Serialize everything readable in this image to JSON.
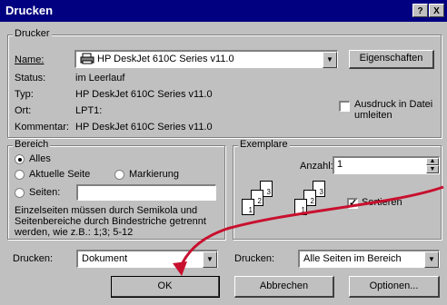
{
  "window": {
    "title": "Drucken",
    "help_glyph": "?",
    "close_glyph": "X"
  },
  "printer": {
    "group_label": "Drucker",
    "name_label": "Name:",
    "name_value": "HP DeskJet 610C Series v11.0",
    "properties_button": "Eigenschaften",
    "status_label": "Status:",
    "status_value": "im Leerlauf",
    "type_label": "Typ:",
    "type_value": "HP DeskJet 610C Series v11.0",
    "location_label": "Ort:",
    "location_value": "LPT1:",
    "comment_label": "Kommentar:",
    "comment_value": "HP DeskJet 610C Series v11.0",
    "print_to_file_label": "Ausdruck in Datei umleiten",
    "print_to_file_checked": false
  },
  "range": {
    "group_label": "Bereich",
    "all_label": "Alles",
    "current_page_label": "Aktuelle Seite",
    "selection_label": "Markierung",
    "pages_label": "Seiten:",
    "pages_value": "",
    "hint": "Einzelseiten müssen durch Semikola und Seitenbereiche durch Bindestriche getrennt werden, wie z.B.: 1;3; 5-12",
    "selected": "all"
  },
  "copies": {
    "group_label": "Exemplare",
    "count_label": "Anzahl:",
    "count_value": "1",
    "collate_label": "Sortieren",
    "collate_checked": true,
    "collate_icon_pages": [
      "1",
      "2",
      "3",
      "1",
      "2",
      "3"
    ]
  },
  "print_what": {
    "label": "Drucken:",
    "value": "Dokument"
  },
  "print_pages": {
    "label": "Drucken:",
    "value": "Alle Seiten im Bereich"
  },
  "buttons": {
    "ok": "OK",
    "cancel": "Abbrechen",
    "options": "Optionen..."
  },
  "colors": {
    "titlebar": "#000080",
    "face": "#c0c0c0",
    "annotation_arrow": "#c8102e"
  },
  "icons": {
    "printer": "printer-icon",
    "dropdown": "chevron-down-icon",
    "spinner": "spinner-arrows-icon"
  }
}
